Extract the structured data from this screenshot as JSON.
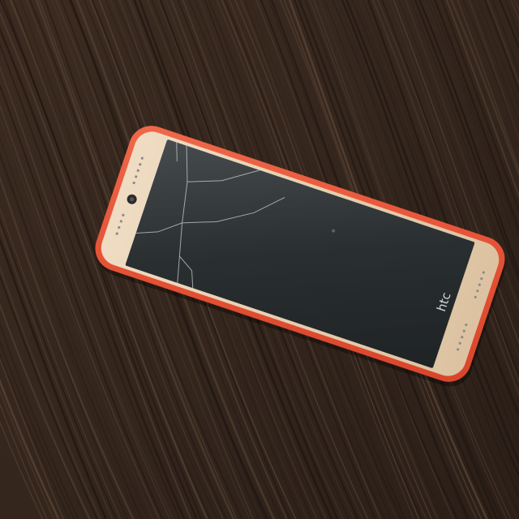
{
  "scene": {
    "description_kind": "photo",
    "surface": "dark-wood-table",
    "object": "smartphone"
  },
  "phone": {
    "brand_logo": "htc",
    "frame_color": "#e85a3c",
    "bezel_color": "#e9d2b4",
    "screen_color": "#2a2e31",
    "screen_state": "off",
    "screen_condition": "cracked"
  },
  "colors": {
    "wood_base": "#3a2a20",
    "wood_dark": "#1e1510",
    "wood_light": "#5a4536"
  }
}
